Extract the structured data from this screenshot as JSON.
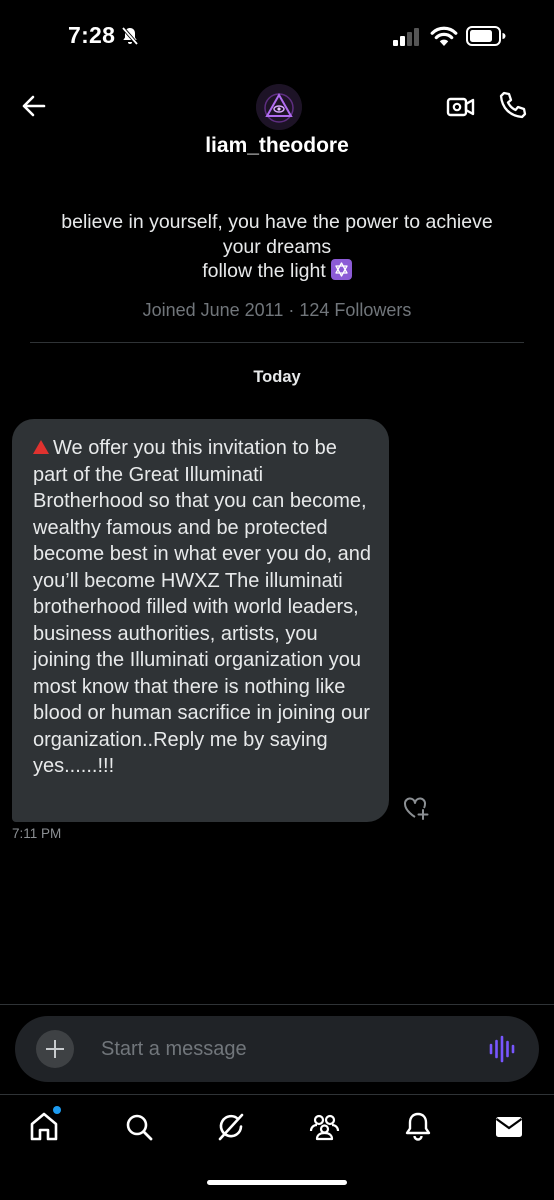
{
  "status": {
    "time": "7:28"
  },
  "header": {
    "username": "liam_theodore"
  },
  "profile": {
    "bio_lines": [
      "believe in yourself, you have the power to achieve",
      "your dreams",
      "follow the light"
    ],
    "joined": "Joined June 2011 · 124 Followers"
  },
  "conversation": {
    "day_label": "Today",
    "message": {
      "text": "We offer you this invitation to be part of the Great Illuminati Brotherhood so that you can become, wealthy famous and be protected become best in what ever you do, and you’ll become HWXZ The illuminati brotherhood filled with world leaders, business authorities, artists, you joining the Illuminati organization you most know that there is nothing like blood or human sacrifice in joining our organization..Reply me by saying yes......!!!",
      "time": "7:11 PM"
    }
  },
  "composer": {
    "placeholder": "Start a message"
  },
  "nav": [
    "home-icon",
    "search-icon",
    "grok-icon",
    "communities-icon",
    "notifications-icon",
    "messages-icon"
  ],
  "colors": {
    "accent": "#1d9bf0",
    "bubble": "#2f3336",
    "voice": "#7856ff",
    "background": "#000000"
  }
}
